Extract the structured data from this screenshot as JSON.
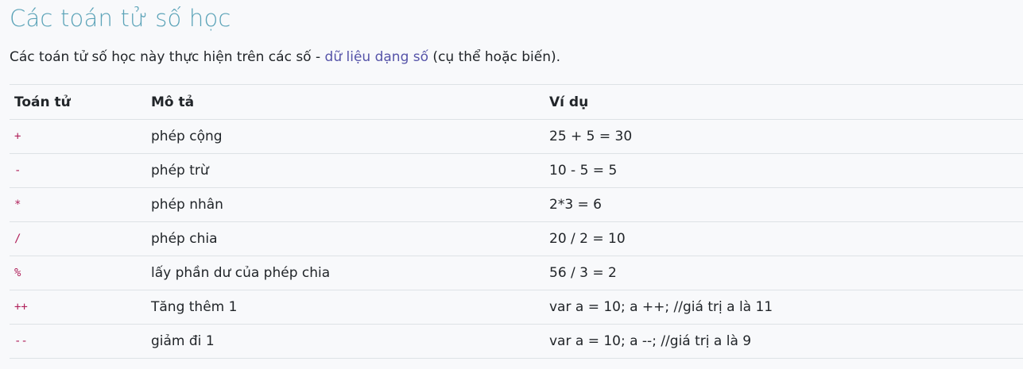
{
  "title": "Các toán tử số học",
  "intro": {
    "before": "Các toán tử số học này thực hiện trên các số - ",
    "link": "dữ liệu dạng số",
    "after": " (cụ thể hoặc biến)."
  },
  "table": {
    "headers": [
      "Toán tử",
      "Mô tả",
      "Ví dụ"
    ],
    "rows": [
      {
        "op": "+",
        "desc": "phép cộng",
        "example": "25 + 5 = 30"
      },
      {
        "op": "-",
        "desc": "phép trừ",
        "example": "10 - 5 = 5"
      },
      {
        "op": "*",
        "desc": "phép nhân",
        "example": "2*3 = 6"
      },
      {
        "op": "/",
        "desc": "phép chia",
        "example": "20 / 2 = 10"
      },
      {
        "op": "%",
        "desc": "lấy phần dư của phép chia",
        "example": "56 / 3 = 2"
      },
      {
        "op": "++",
        "desc": "Tăng thêm 1",
        "example": "var a = 10; a ++; //giá trị a là 11"
      },
      {
        "op": "--",
        "desc": "giảm đi 1",
        "example": "var a = 10; a --; //giá trị a là 9"
      }
    ]
  },
  "colors": {
    "title": "#5ba3b8",
    "link": "#5553a8",
    "operator": "#b0205a",
    "text": "#212529",
    "background": "#f8f9fb",
    "border": "#dee2e6"
  }
}
